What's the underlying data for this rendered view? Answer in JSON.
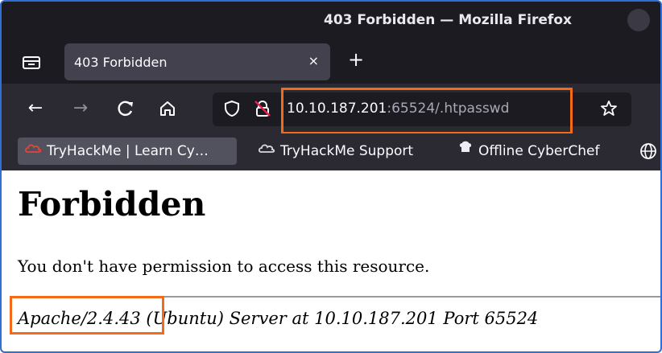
{
  "window": {
    "title": "403 Forbidden — Mozilla Firefox"
  },
  "tabs": [
    {
      "label": "403 Forbidden",
      "close_glyph": "×"
    }
  ],
  "newtab_glyph": "+",
  "nav": {
    "back_glyph": "←",
    "forward_glyph": "→",
    "reload_glyph": "C",
    "home_glyph": "⌂"
  },
  "url": {
    "host": "10.10.187.201",
    "rest": ":65524/.htpasswd"
  },
  "bookmarks": [
    {
      "label": "TryHackMe | Learn Cy…",
      "icon": "tryhackme-icon"
    },
    {
      "label": "TryHackMe Support",
      "icon": "cloud-icon"
    },
    {
      "label": "Offline CyberChef",
      "icon": "chef-icon"
    }
  ],
  "page": {
    "heading": "Forbidden",
    "message": "You don't have permission to access this resource.",
    "server_version": "Apache/2.4.43",
    "server_rest": " (Ubuntu) Server at 10.10.187.201 Port 65524"
  },
  "colors": {
    "highlight": "#f36a18",
    "frame": "#2f6fd6"
  }
}
